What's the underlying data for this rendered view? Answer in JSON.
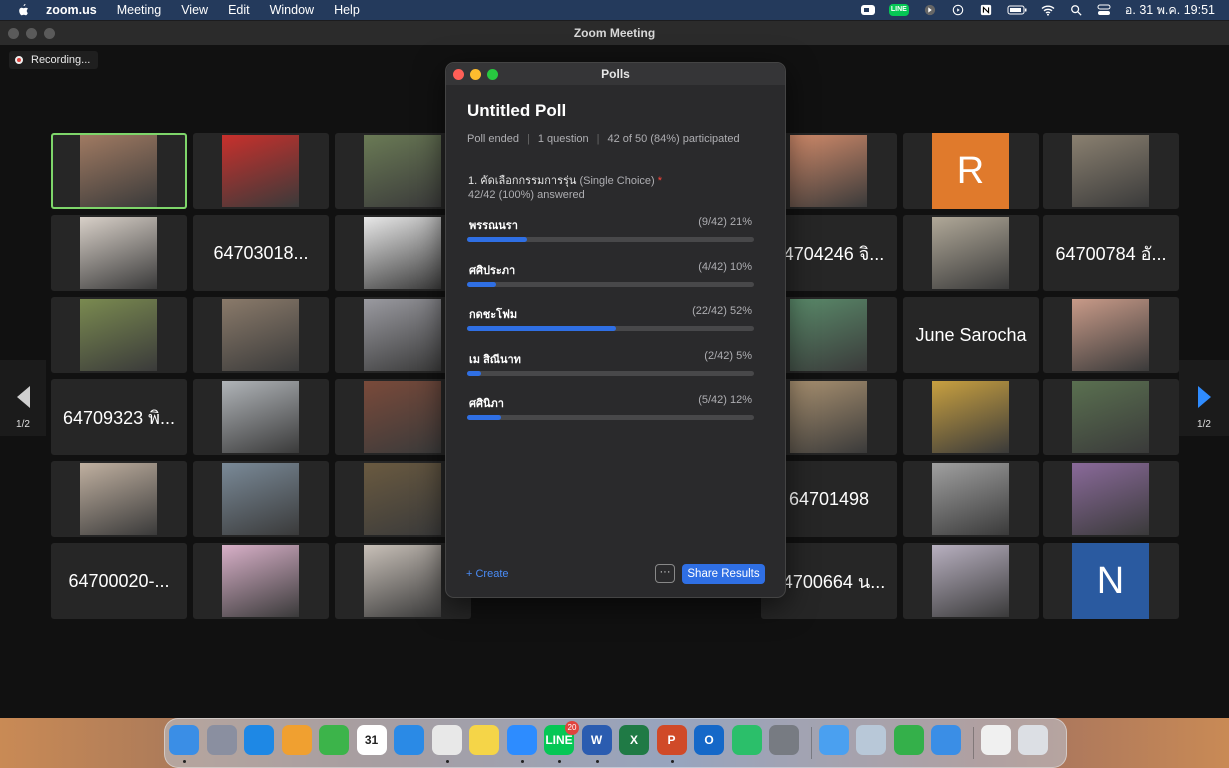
{
  "menubar": {
    "app": "zoom.us",
    "items": [
      "Meeting",
      "View",
      "Edit",
      "Window",
      "Help"
    ],
    "line_icon": "LINE",
    "datetime": "อ. 31 พ.ค.  19:51"
  },
  "window": {
    "title": "Zoom Meeting",
    "recording_label": "Recording..."
  },
  "gallery": {
    "page_label": "1/2",
    "tiles": [
      {
        "kind": "photo",
        "color": "#a07a62",
        "active": true
      },
      {
        "kind": "photo",
        "color": "#c8302c"
      },
      {
        "kind": "photo",
        "color": "#6a7a55"
      },
      {
        "kind": "hidden"
      },
      {
        "kind": "hidden"
      },
      {
        "kind": "photo",
        "color": "#d08a6a"
      },
      {
        "kind": "avatar",
        "letter": "R",
        "color": "#e07a2c"
      },
      {
        "kind": "photo",
        "color": "#8a8070"
      },
      {
        "kind": "photo",
        "color": "#d8d0c8"
      },
      {
        "kind": "name",
        "text": "64703018..."
      },
      {
        "kind": "photo",
        "color": "#e8e8e8"
      },
      {
        "kind": "hidden"
      },
      {
        "kind": "hidden"
      },
      {
        "kind": "name",
        "text": "64704246 จิ..."
      },
      {
        "kind": "photo",
        "color": "#b0a898"
      },
      {
        "kind": "name",
        "text": "64700784 อั..."
      },
      {
        "kind": "photo",
        "color": "#7a8a50"
      },
      {
        "kind": "photo",
        "color": "#8a7a6a"
      },
      {
        "kind": "photo",
        "color": "#9a9aa0"
      },
      {
        "kind": "hidden"
      },
      {
        "kind": "hidden"
      },
      {
        "kind": "photo",
        "color": "#5a8a6a"
      },
      {
        "kind": "name",
        "text": "June Sarocha"
      },
      {
        "kind": "photo",
        "color": "#c89a88"
      },
      {
        "kind": "name",
        "text": "64709323 พิ..."
      },
      {
        "kind": "photo",
        "color": "#b0b4b8"
      },
      {
        "kind": "photo",
        "color": "#7a4a3a"
      },
      {
        "kind": "hidden"
      },
      {
        "kind": "hidden"
      },
      {
        "kind": "photo",
        "color": "#a89070"
      },
      {
        "kind": "photo",
        "color": "#c8a040"
      },
      {
        "kind": "photo",
        "color": "#5a7050"
      },
      {
        "kind": "photo",
        "color": "#c0b0a0"
      },
      {
        "kind": "photo",
        "color": "#7a8a98"
      },
      {
        "kind": "photo",
        "color": "#6a5a40"
      },
      {
        "kind": "hidden"
      },
      {
        "kind": "hidden"
      },
      {
        "kind": "name",
        "text": "64701498"
      },
      {
        "kind": "photo",
        "color": "#a0a0a0"
      },
      {
        "kind": "photo",
        "color": "#8a6a9a"
      },
      {
        "kind": "name",
        "text": "64700020-..."
      },
      {
        "kind": "photo",
        "color": "#d8b0c8"
      },
      {
        "kind": "photo",
        "color": "#c8c0b8"
      },
      {
        "kind": "hidden"
      },
      {
        "kind": "hidden"
      },
      {
        "kind": "name",
        "text": "64700664 น..."
      },
      {
        "kind": "photo",
        "color": "#b8b0c0"
      },
      {
        "kind": "avatar",
        "letter": "N",
        "color": "#2a5aa0"
      }
    ]
  },
  "poll": {
    "window_title": "Polls",
    "title": "Untitled Poll",
    "status": "Poll ended",
    "question_count": "1 question",
    "participation": "42 of 50 (84%) participated",
    "question": "1. คัดเลือกกรรมการรุ่น",
    "question_type": "(Single Choice)",
    "required_mark": "*",
    "answered": "42/42 (100%) answered",
    "options": [
      {
        "label": "พรรณนรา",
        "count": "(9/42) 21%",
        "fraction": 0.21
      },
      {
        "label": "ศศิประภา",
        "count": "(4/42) 10%",
        "fraction": 0.1
      },
      {
        "label": "กดชะโฟม",
        "count": "(22/42) 52%",
        "fraction": 0.52
      },
      {
        "label": "เม สิณีนาท",
        "count": "(2/42) 5%",
        "fraction": 0.05
      },
      {
        "label": "ศศินิภา",
        "count": "(5/42) 12%",
        "fraction": 0.12
      }
    ],
    "create_label": "+ Create",
    "more_label": "···",
    "share_label": "Share Results"
  },
  "dock": {
    "apps": [
      {
        "name": "finder-icon",
        "color": "#3a8ee6",
        "running": true
      },
      {
        "name": "launchpad-icon",
        "color": "#8a8fa0"
      },
      {
        "name": "app-store-icon",
        "color": "#1e88e5"
      },
      {
        "name": "photos-icon",
        "color": "#f0a030"
      },
      {
        "name": "facetime-icon",
        "color": "#3cb44a"
      },
      {
        "name": "calendar-icon",
        "color": "#ffffff",
        "text": "31"
      },
      {
        "name": "safari-icon",
        "color": "#2a8ae6"
      },
      {
        "name": "chrome-icon",
        "color": "#e8e8e8",
        "running": true
      },
      {
        "name": "notes-icon",
        "color": "#f5d548"
      },
      {
        "name": "zoom-icon",
        "color": "#2d8cff",
        "running": true
      },
      {
        "name": "line-icon",
        "color": "#06c755",
        "text": "LINE",
        "badge": "20",
        "running": true
      },
      {
        "name": "word-icon",
        "color": "#2b5cb0",
        "text": "W",
        "running": true
      },
      {
        "name": "excel-icon",
        "color": "#1f7a45",
        "text": "X"
      },
      {
        "name": "powerpoint-icon",
        "color": "#d04a28",
        "text": "P",
        "running": true
      },
      {
        "name": "outlook-icon",
        "color": "#1568c8",
        "text": "O"
      },
      {
        "name": "mi-home-icon",
        "color": "#2bbf6a"
      },
      {
        "name": "system-preferences-icon",
        "color": "#777b82"
      },
      {
        "name": "mail-icon",
        "color": "#4aa0f0"
      },
      {
        "name": "preview-icon",
        "color": "#b8c8d8"
      },
      {
        "name": "numbers-icon",
        "color": "#34b04a"
      },
      {
        "name": "safari-download-icon",
        "color": "#3a8ee6"
      },
      {
        "name": "document-stack-icon",
        "color": "#f0f0f0"
      },
      {
        "name": "trash-icon",
        "color": "#dcdfe4"
      }
    ]
  }
}
